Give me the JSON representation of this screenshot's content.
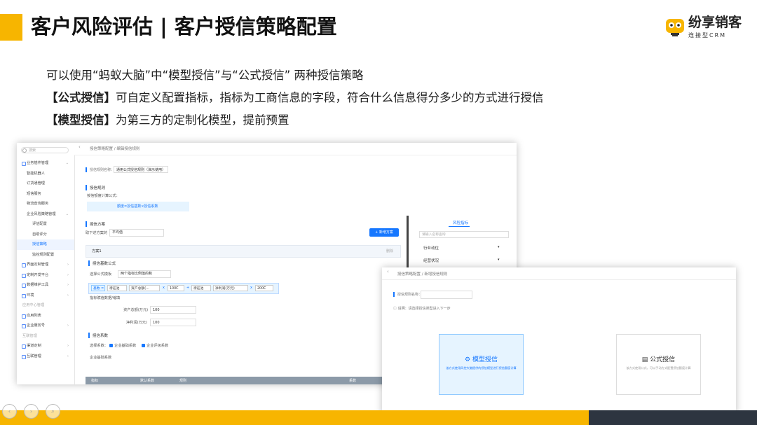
{
  "slide": {
    "title": "客户风险评估 | 客户授信策略配置",
    "logo_text": "纷享销客",
    "logo_sub": "连接型CRM",
    "intro": "可以使用“蚂蚁大脑”中“模型授信”与“公式授信” 两种授信策略",
    "formula_label": "【公式授信】",
    "formula_desc": "可自定义配置指标，指标为工商信息的字段，符合什么信息得分多少的方式进行授信",
    "model_label": "【模型授信】",
    "model_desc": "为第三方的定制化模型，提前预置"
  },
  "colors": {
    "accent": "#f7b500",
    "primary": "#1677ff",
    "dark": "#2d3540"
  },
  "screen1": {
    "search_placeholder": "搜索",
    "breadcrumb": "授信策略配置 / 编辑授信规则",
    "menu": [
      {
        "label": "业务插件管理",
        "level": "l1",
        "arrow": "⌄"
      },
      {
        "label": "智能机器人",
        "level": "l2"
      },
      {
        "label": "订货通管理",
        "level": "l2"
      },
      {
        "label": "短信服务",
        "level": "l2"
      },
      {
        "label": "物流查询服务",
        "level": "l2"
      },
      {
        "label": "企业风险策略管理",
        "level": "l2",
        "arrow": "⌄"
      },
      {
        "label": "评估配置",
        "level": "l3"
      },
      {
        "label": "自助评分",
        "level": "l3"
      },
      {
        "label": "授信策略",
        "level": "l3",
        "active": true
      },
      {
        "label": "监控规则配置",
        "level": "l3"
      },
      {
        "label": "界面定制管理",
        "level": "l1",
        "arrow": "›"
      },
      {
        "label": "定制开发平台",
        "level": "l1",
        "arrow": "›"
      },
      {
        "label": "数据维护工具",
        "level": "l1",
        "arrow": "›"
      },
      {
        "label": "环境",
        "level": "l1",
        "arrow": "›"
      },
      {
        "label": "应用中心管理",
        "level": "group"
      },
      {
        "label": "应用列表",
        "level": "l1"
      },
      {
        "label": "企业服务号",
        "level": "l1",
        "arrow": "›"
      },
      {
        "label": "互联管理",
        "level": "group"
      },
      {
        "label": "渠道定制",
        "level": "l1",
        "arrow": "›"
      },
      {
        "label": "互联管理",
        "level": "l1",
        "arrow": "›"
      }
    ],
    "rule_name_label": "授信规则名称：",
    "rule_name_value": "通用公式授信规则（演示使用）",
    "section_rule": "授信规则",
    "amount_formula_label": "授信额度计算公式：",
    "amount_formula": "额度=授信基数×授信系数",
    "section_plan": "授信方案",
    "plan_mode_label": "取下述方案的",
    "plan_mode_value": "平均值",
    "add_plan": "+ 新增方案",
    "plan_name": "方案1",
    "plan_delete": "删除",
    "section_base": "授信基数公式",
    "formula_template_label": "选择公式模板",
    "formula_template_value": "两个指标比例值的和",
    "cond": {
      "base": "基数 =",
      "a1": "待征池",
      "a2": "资产总额(…",
      "op1": "x",
      "c1": "100C",
      "op2": "+",
      "b1": "待征池",
      "b2": "净利润(万元)",
      "op3": "x",
      "c2": "200C"
    },
    "field_values_label": "指标赋值数据/缩填",
    "asset_label": "资产总额(万元)",
    "asset_value": "100",
    "profit_label": "净利润(万元)",
    "profit_value": "100",
    "section_coef": "授信系数",
    "coef_select_label": "选择系数：",
    "coef_1": "企业基础系数",
    "coef_2": "企业评级系数",
    "coef_base_title": "企业基础系数",
    "table_headers": [
      "指标",
      "默认系数",
      "规则",
      "系数"
    ],
    "right_tab": "风险指标",
    "right_search": "请输入名称查询",
    "right_items": [
      "行业动位",
      "经营状况"
    ]
  },
  "screen2": {
    "breadcrumb": "授信策略配置 / 新增授信规则",
    "name_label": "授信规则名称：",
    "note": "说明：请选择授信类型进入下一步",
    "card_model_title": "模型授信",
    "card_model_desc": "该方式使用风控大脑提供的授信模型进行授信额度计算",
    "card_formula_title": "公式授信",
    "card_formula_desc": "该方式使用公式，可以手动方式配置授信额度计算"
  }
}
